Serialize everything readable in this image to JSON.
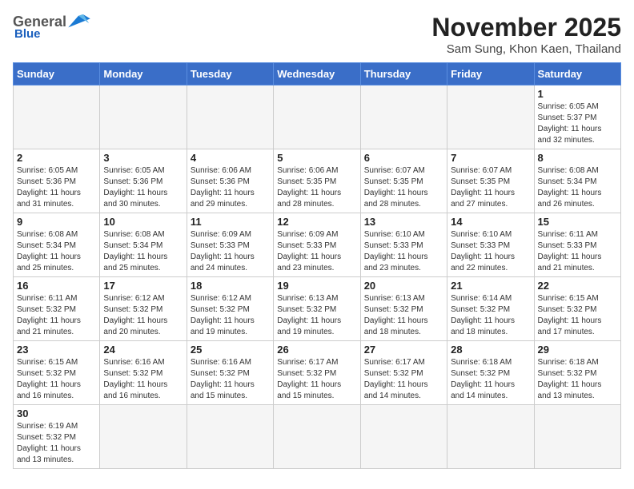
{
  "header": {
    "logo": {
      "general": "General",
      "blue": "Blue"
    },
    "title": "November 2025",
    "location": "Sam Sung, Khon Kaen, Thailand"
  },
  "weekdays": [
    "Sunday",
    "Monday",
    "Tuesday",
    "Wednesday",
    "Thursday",
    "Friday",
    "Saturday"
  ],
  "weeks": [
    [
      {
        "day": "",
        "info": ""
      },
      {
        "day": "",
        "info": ""
      },
      {
        "day": "",
        "info": ""
      },
      {
        "day": "",
        "info": ""
      },
      {
        "day": "",
        "info": ""
      },
      {
        "day": "",
        "info": ""
      },
      {
        "day": "1",
        "info": "Sunrise: 6:05 AM\nSunset: 5:37 PM\nDaylight: 11 hours\nand 32 minutes."
      }
    ],
    [
      {
        "day": "2",
        "info": "Sunrise: 6:05 AM\nSunset: 5:36 PM\nDaylight: 11 hours\nand 31 minutes."
      },
      {
        "day": "3",
        "info": "Sunrise: 6:05 AM\nSunset: 5:36 PM\nDaylight: 11 hours\nand 30 minutes."
      },
      {
        "day": "4",
        "info": "Sunrise: 6:06 AM\nSunset: 5:36 PM\nDaylight: 11 hours\nand 29 minutes."
      },
      {
        "day": "5",
        "info": "Sunrise: 6:06 AM\nSunset: 5:35 PM\nDaylight: 11 hours\nand 28 minutes."
      },
      {
        "day": "6",
        "info": "Sunrise: 6:07 AM\nSunset: 5:35 PM\nDaylight: 11 hours\nand 28 minutes."
      },
      {
        "day": "7",
        "info": "Sunrise: 6:07 AM\nSunset: 5:35 PM\nDaylight: 11 hours\nand 27 minutes."
      },
      {
        "day": "8",
        "info": "Sunrise: 6:08 AM\nSunset: 5:34 PM\nDaylight: 11 hours\nand 26 minutes."
      }
    ],
    [
      {
        "day": "9",
        "info": "Sunrise: 6:08 AM\nSunset: 5:34 PM\nDaylight: 11 hours\nand 25 minutes."
      },
      {
        "day": "10",
        "info": "Sunrise: 6:08 AM\nSunset: 5:34 PM\nDaylight: 11 hours\nand 25 minutes."
      },
      {
        "day": "11",
        "info": "Sunrise: 6:09 AM\nSunset: 5:33 PM\nDaylight: 11 hours\nand 24 minutes."
      },
      {
        "day": "12",
        "info": "Sunrise: 6:09 AM\nSunset: 5:33 PM\nDaylight: 11 hours\nand 23 minutes."
      },
      {
        "day": "13",
        "info": "Sunrise: 6:10 AM\nSunset: 5:33 PM\nDaylight: 11 hours\nand 23 minutes."
      },
      {
        "day": "14",
        "info": "Sunrise: 6:10 AM\nSunset: 5:33 PM\nDaylight: 11 hours\nand 22 minutes."
      },
      {
        "day": "15",
        "info": "Sunrise: 6:11 AM\nSunset: 5:33 PM\nDaylight: 11 hours\nand 21 minutes."
      }
    ],
    [
      {
        "day": "16",
        "info": "Sunrise: 6:11 AM\nSunset: 5:32 PM\nDaylight: 11 hours\nand 21 minutes."
      },
      {
        "day": "17",
        "info": "Sunrise: 6:12 AM\nSunset: 5:32 PM\nDaylight: 11 hours\nand 20 minutes."
      },
      {
        "day": "18",
        "info": "Sunrise: 6:12 AM\nSunset: 5:32 PM\nDaylight: 11 hours\nand 19 minutes."
      },
      {
        "day": "19",
        "info": "Sunrise: 6:13 AM\nSunset: 5:32 PM\nDaylight: 11 hours\nand 19 minutes."
      },
      {
        "day": "20",
        "info": "Sunrise: 6:13 AM\nSunset: 5:32 PM\nDaylight: 11 hours\nand 18 minutes."
      },
      {
        "day": "21",
        "info": "Sunrise: 6:14 AM\nSunset: 5:32 PM\nDaylight: 11 hours\nand 18 minutes."
      },
      {
        "day": "22",
        "info": "Sunrise: 6:15 AM\nSunset: 5:32 PM\nDaylight: 11 hours\nand 17 minutes."
      }
    ],
    [
      {
        "day": "23",
        "info": "Sunrise: 6:15 AM\nSunset: 5:32 PM\nDaylight: 11 hours\nand 16 minutes."
      },
      {
        "day": "24",
        "info": "Sunrise: 6:16 AM\nSunset: 5:32 PM\nDaylight: 11 hours\nand 16 minutes."
      },
      {
        "day": "25",
        "info": "Sunrise: 6:16 AM\nSunset: 5:32 PM\nDaylight: 11 hours\nand 15 minutes."
      },
      {
        "day": "26",
        "info": "Sunrise: 6:17 AM\nSunset: 5:32 PM\nDaylight: 11 hours\nand 15 minutes."
      },
      {
        "day": "27",
        "info": "Sunrise: 6:17 AM\nSunset: 5:32 PM\nDaylight: 11 hours\nand 14 minutes."
      },
      {
        "day": "28",
        "info": "Sunrise: 6:18 AM\nSunset: 5:32 PM\nDaylight: 11 hours\nand 14 minutes."
      },
      {
        "day": "29",
        "info": "Sunrise: 6:18 AM\nSunset: 5:32 PM\nDaylight: 11 hours\nand 13 minutes."
      }
    ],
    [
      {
        "day": "30",
        "info": "Sunrise: 6:19 AM\nSunset: 5:32 PM\nDaylight: 11 hours\nand 13 minutes."
      },
      {
        "day": "",
        "info": ""
      },
      {
        "day": "",
        "info": ""
      },
      {
        "day": "",
        "info": ""
      },
      {
        "day": "",
        "info": ""
      },
      {
        "day": "",
        "info": ""
      },
      {
        "day": "",
        "info": ""
      }
    ]
  ]
}
